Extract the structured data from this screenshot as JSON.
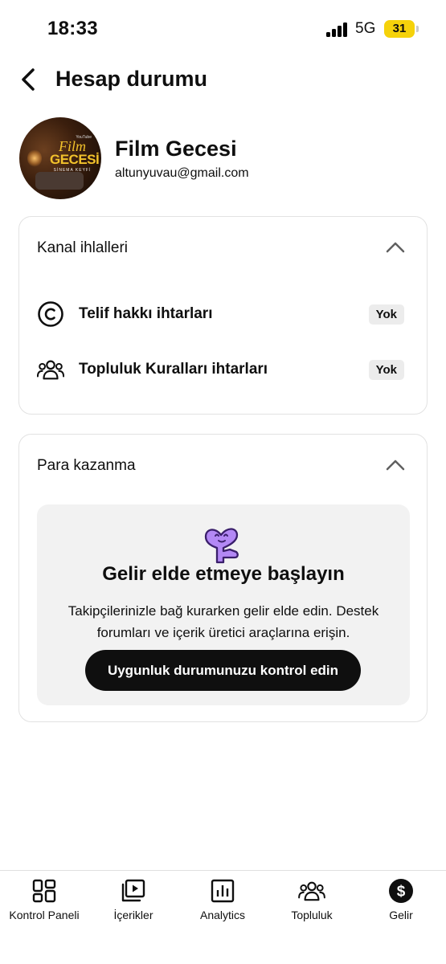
{
  "status_bar": {
    "time": "18:33",
    "network": "5G",
    "battery": "31",
    "battery_color": "#f5d20b"
  },
  "header": {
    "back_icon": "chevron-left-icon",
    "title": "Hesap durumu"
  },
  "profile": {
    "avatar_small": "YouTube",
    "avatar_line1": "Film",
    "avatar_line2": "GECESİ",
    "avatar_line3": "SİNEMA KEYFİ",
    "name": "Film Gecesi",
    "email": "altunyuvau@gmail.com"
  },
  "violations": {
    "title": "Kanal ihlalleri",
    "items": [
      {
        "icon": "copyright-icon",
        "label": "Telif hakkı ihtarları",
        "status": "Yok"
      },
      {
        "icon": "community-icon",
        "label": "Topluluk Kuralları ihtarları",
        "status": "Yok"
      }
    ]
  },
  "monetization": {
    "title": "Para kazanma",
    "promo_title": "Gelir elde etmeye başlayın",
    "promo_desc": "Takipçilerinizle bağ kurarken gelir elde edin. Destek forumları ve içerik üretici araçlarına erişin.",
    "promo_button": "Uygunluk durumunuzu kontrol edin",
    "accent_color": "#b388f5"
  },
  "bottom_nav": [
    {
      "icon": "dashboard-icon",
      "label": "Kontrol Paneli"
    },
    {
      "icon": "content-icon",
      "label": "İçerikler"
    },
    {
      "icon": "analytics-icon",
      "label": "Analytics"
    },
    {
      "icon": "community-icon",
      "label": "Topluluk"
    },
    {
      "icon": "earn-icon",
      "label": "Gelir"
    }
  ]
}
